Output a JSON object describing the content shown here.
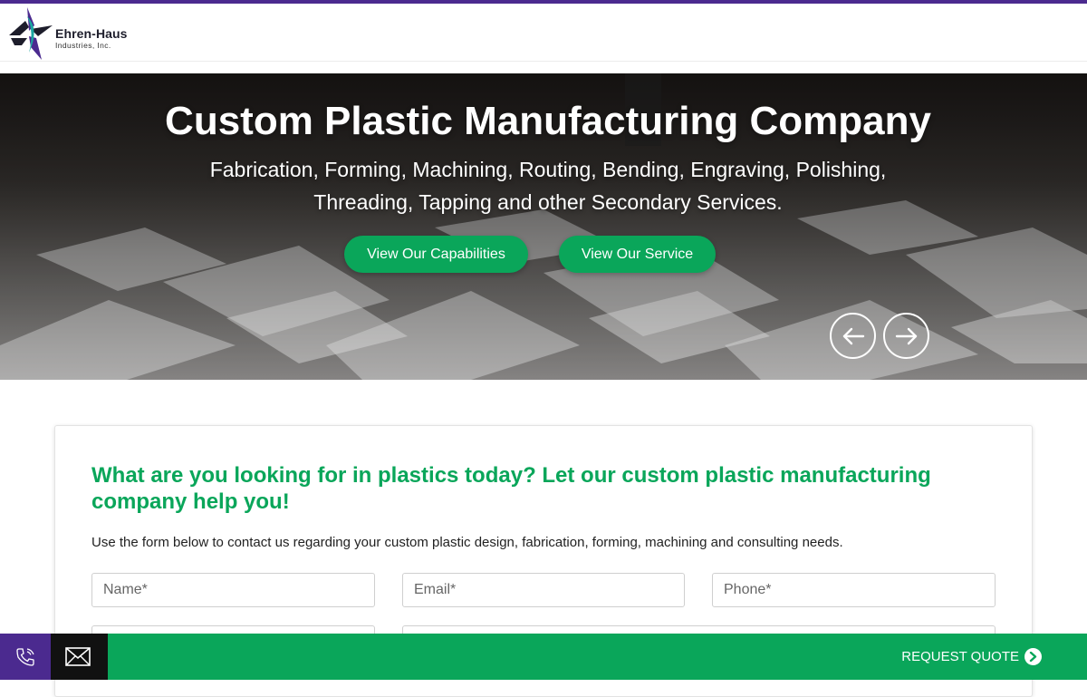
{
  "brand": {
    "name": "Ehren-Haus",
    "sub": "Industries, Inc.",
    "colors": {
      "purple": "#4b2a8f",
      "green": "#0aa65a",
      "teal": "#1aa6a0",
      "dark": "#1d1d2b"
    }
  },
  "hero": {
    "title": "Custom Plastic Manufacturing Company",
    "subtitle": "Fabrication, Forming, Machining, Routing, Bending, Engraving, Polishing, Threading, Tapping and other Secondary Services.",
    "buttons": {
      "capabilities": "View Our Capabilities",
      "service": "View Our Service"
    },
    "carousel": {
      "prev_icon": "arrow-left-icon",
      "next_icon": "arrow-right-icon"
    }
  },
  "form": {
    "heading": "What are you looking for in plastics today? Let our custom plastic manufacturing company help you!",
    "description": "Use the form below to contact us regarding your custom plastic design, fabrication, forming, machining and consulting needs.",
    "fields": {
      "name": {
        "placeholder": "Name*",
        "value": ""
      },
      "email": {
        "placeholder": "Email*",
        "value": ""
      },
      "phone": {
        "placeholder": "Phone*",
        "value": ""
      }
    }
  },
  "bottom_bar": {
    "phone_icon": "phone-icon",
    "mail_icon": "envelope-icon",
    "quote_label": "REQUEST QUOTE",
    "quote_icon": "chevron-right-circle-icon"
  }
}
